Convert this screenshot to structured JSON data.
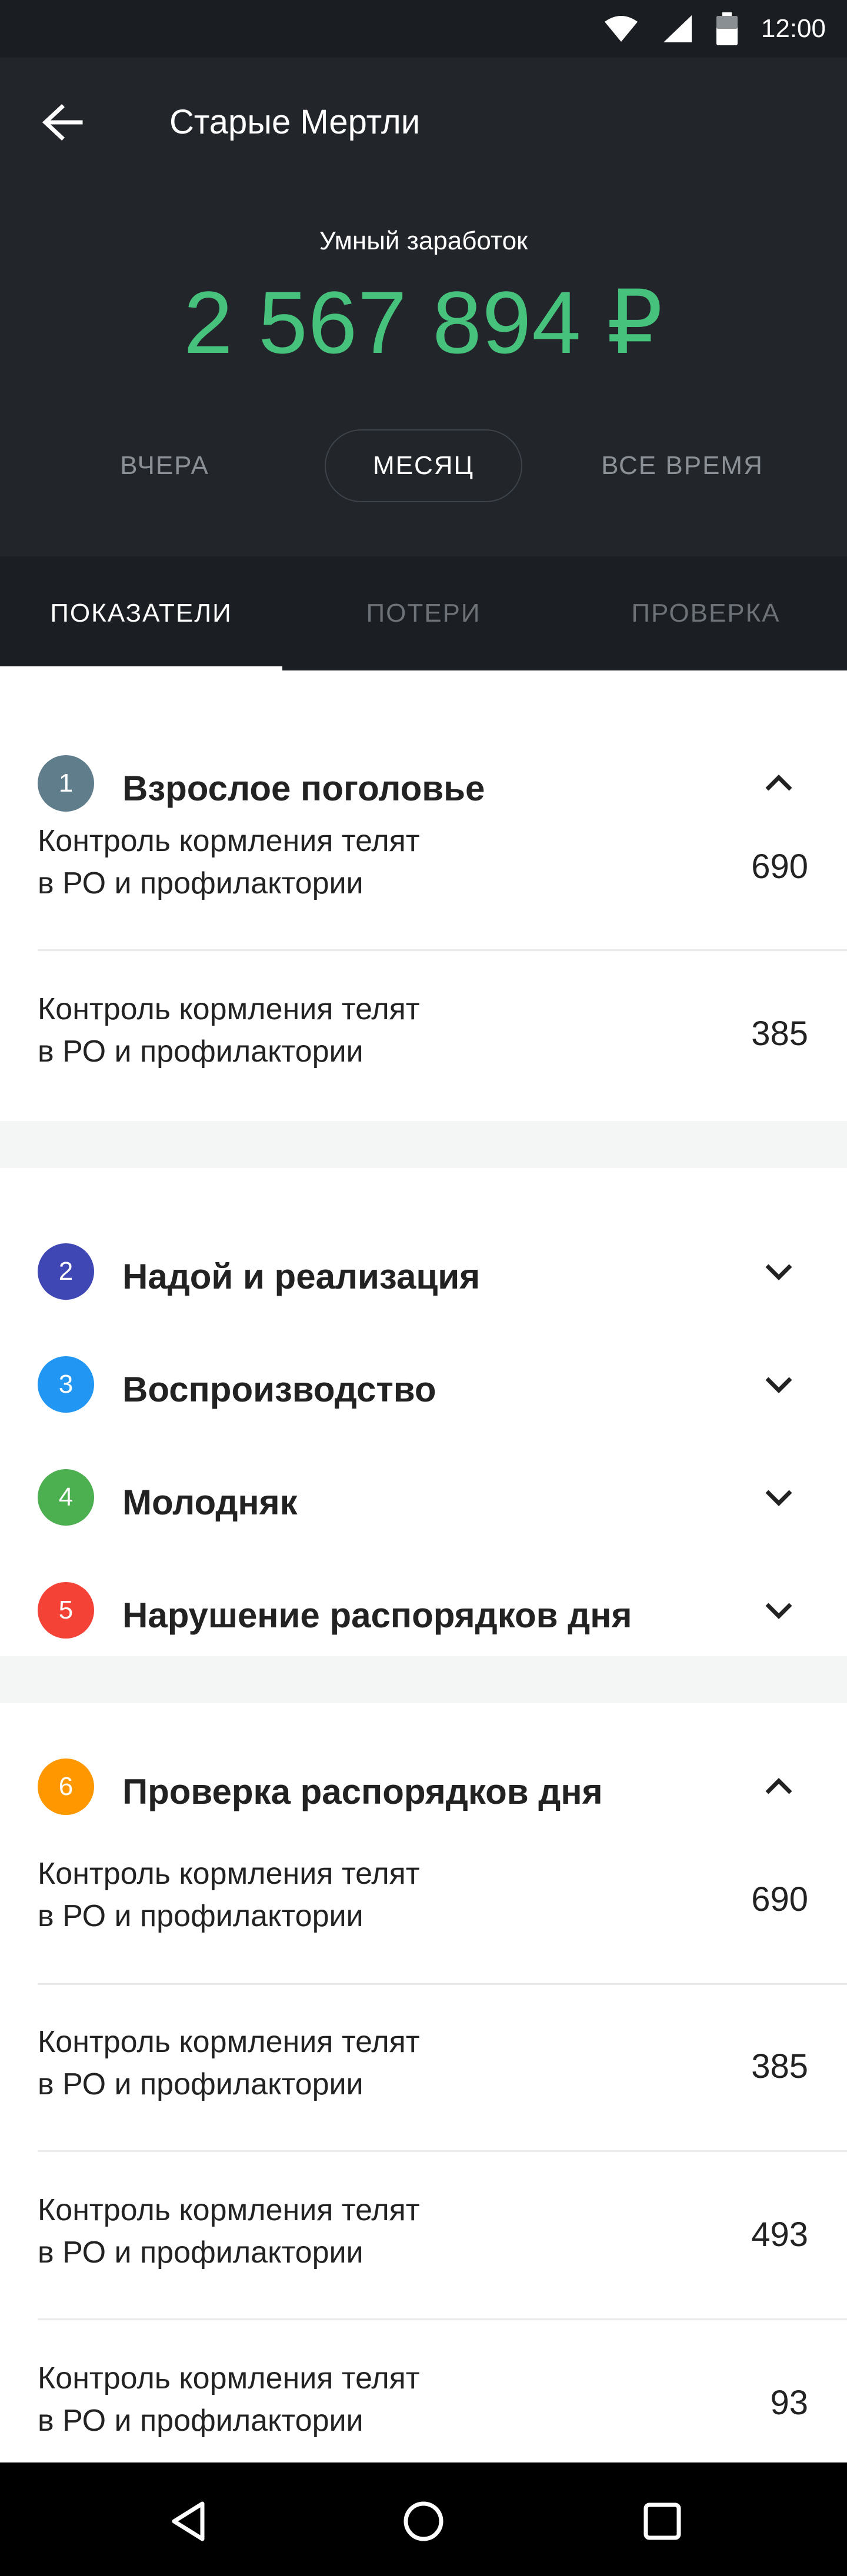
{
  "status_bar": {
    "time": "12:00",
    "icons": [
      "wifi-icon",
      "signal-icon",
      "battery-icon"
    ]
  },
  "app_bar": {
    "title": "Старые Мертли",
    "back_icon": "arrow-back-icon"
  },
  "earnings": {
    "label": "Умный заработок",
    "value": "2 567 894 ₽",
    "value_color": "#46c27d"
  },
  "periods": [
    "ВЧЕРА",
    "МЕСЯЦ",
    "ВСЕ ВРЕМЯ"
  ],
  "tabs": [
    "ПОКАЗАТЕЛИ",
    "ПОТЕРИ",
    "ПРОВЕРКА"
  ],
  "groups": [
    {
      "num": "1",
      "title": "Взрослое поголовье",
      "color": "#607d8b",
      "expanded": true,
      "rows": [
        {
          "line1": "Контроль кормления телят",
          "line2": "в РО и профилактории",
          "value": "690"
        },
        {
          "line1": "Контроль кормления телят",
          "line2": "в РО и профилактории",
          "value": "385"
        }
      ]
    },
    {
      "num": "2",
      "title": "Надой и реализация",
      "color": "#3f47b5",
      "expanded": false
    },
    {
      "num": "3",
      "title": "Воспроизводство",
      "color": "#2196f3",
      "expanded": false
    },
    {
      "num": "4",
      "title": "Молодняк",
      "color": "#4caf50",
      "expanded": false
    },
    {
      "num": "5",
      "title": "Нарушение распорядков дня",
      "color": "#f44336",
      "expanded": false
    },
    {
      "num": "6",
      "title": "Проверка распорядков дня",
      "color": "#ff9800",
      "expanded": true,
      "rows": [
        {
          "line1": "Контроль кормления телят",
          "line2": "в РО и профилактории",
          "value": "690"
        },
        {
          "line1": "Контроль кормления телят",
          "line2": "в РО и профилактории",
          "value": "385"
        },
        {
          "line1": "Контроль кормления телят",
          "line2": "в РО и профилактории",
          "value": "493"
        },
        {
          "line1": "Контроль кормления телят",
          "line2": "в РО и профилактории",
          "value": "93"
        }
      ]
    }
  ],
  "nav_bar": [
    "back-triangle-icon",
    "home-circle-icon",
    "recents-square-icon"
  ]
}
